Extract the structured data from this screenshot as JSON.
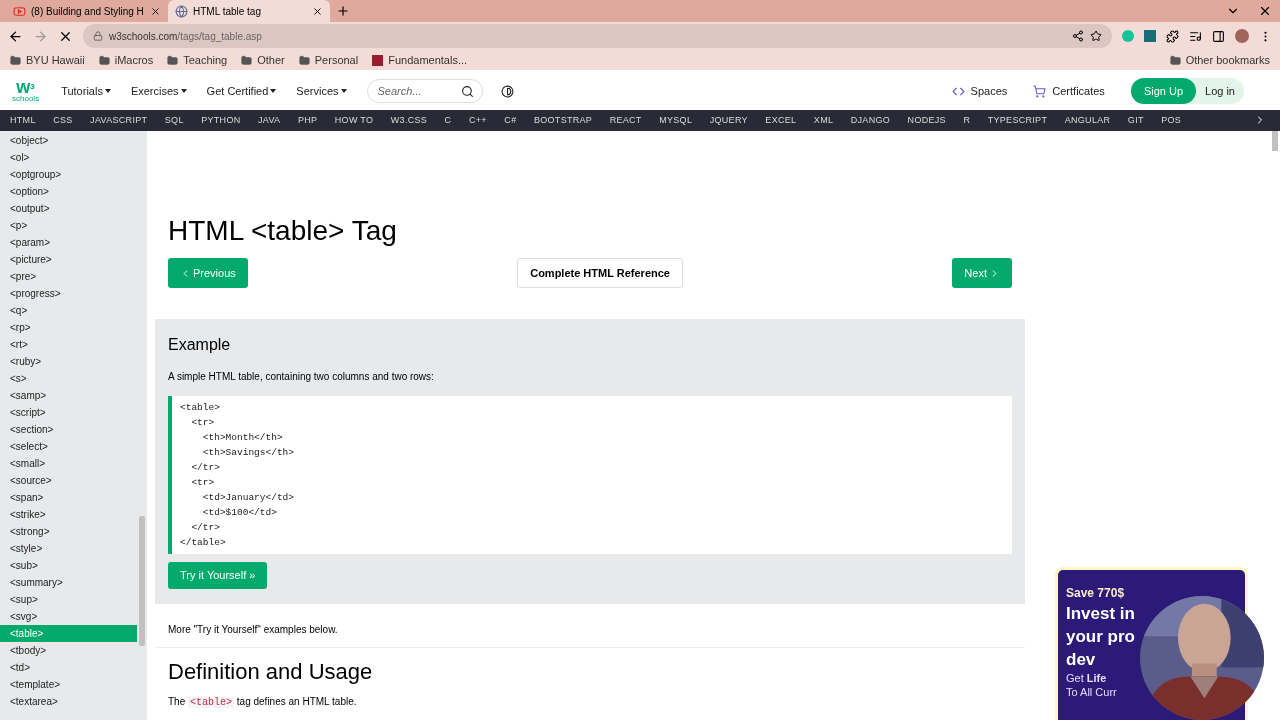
{
  "browser": {
    "tabs": [
      {
        "title": "(8) Building and Styling H",
        "selected": false,
        "kind": "video"
      },
      {
        "title": "HTML table tag",
        "selected": true,
        "kind": "web"
      }
    ],
    "url": {
      "host": "w3schools.com",
      "path": "/tags/tag_table.asp"
    },
    "bookmarks": [
      {
        "label": "BYU Hawaii",
        "kind": "folder"
      },
      {
        "label": "iMacros",
        "kind": "folder"
      },
      {
        "label": "Teaching",
        "kind": "folder"
      },
      {
        "label": "Other",
        "kind": "folder"
      },
      {
        "label": "Personal",
        "kind": "folder"
      },
      {
        "label": "Fundamentals...",
        "kind": "site"
      }
    ],
    "other_bookmarks": "Other bookmarks"
  },
  "header": {
    "logo": {
      "mark": "w",
      "sup": "3",
      "word": "schools"
    },
    "menus": [
      "Tutorials",
      "Exercises",
      "Get Certified",
      "Services"
    ],
    "search": {
      "placeholder": "Search..."
    },
    "links": [
      {
        "label": "Spaces",
        "kind": "code"
      },
      {
        "label": "Certficates",
        "kind": "cart"
      }
    ],
    "sign_up": "Sign Up",
    "log_in": "Log in"
  },
  "topnav": [
    "HTML",
    "CSS",
    "JAVASCRIPT",
    "SQL",
    "PYTHON",
    "JAVA",
    "PHP",
    "HOW TO",
    "W3.CSS",
    "C",
    "C++",
    "C#",
    "BOOTSTRAP",
    "REACT",
    "MYSQL",
    "JQUERY",
    "EXCEL",
    "XML",
    "DJANGO",
    "NODEJS",
    "R",
    "TYPESCRIPT",
    "ANGULAR",
    "GIT",
    "POS"
  ],
  "sidebar": {
    "items": [
      {
        "label": "<object>",
        "selected": false
      },
      {
        "label": "<ol>",
        "selected": false
      },
      {
        "label": "<optgroup>",
        "selected": false
      },
      {
        "label": "<option>",
        "selected": false
      },
      {
        "label": "<output>",
        "selected": false
      },
      {
        "label": "<p>",
        "selected": false
      },
      {
        "label": "<param>",
        "selected": false
      },
      {
        "label": "<picture>",
        "selected": false
      },
      {
        "label": "<pre>",
        "selected": false
      },
      {
        "label": "<progress>",
        "selected": false
      },
      {
        "label": "<q>",
        "selected": false
      },
      {
        "label": "<rp>",
        "selected": false
      },
      {
        "label": "<rt>",
        "selected": false
      },
      {
        "label": "<ruby>",
        "selected": false
      },
      {
        "label": "<s>",
        "selected": false
      },
      {
        "label": "<samp>",
        "selected": false
      },
      {
        "label": "<script>",
        "selected": false
      },
      {
        "label": "<section>",
        "selected": false
      },
      {
        "label": "<select>",
        "selected": false
      },
      {
        "label": "<small>",
        "selected": false
      },
      {
        "label": "<source>",
        "selected": false
      },
      {
        "label": "<span>",
        "selected": false
      },
      {
        "label": "<strike>",
        "selected": false
      },
      {
        "label": "<strong>",
        "selected": false
      },
      {
        "label": "<style>",
        "selected": false
      },
      {
        "label": "<sub>",
        "selected": false
      },
      {
        "label": "<summary>",
        "selected": false
      },
      {
        "label": "<sup>",
        "selected": false
      },
      {
        "label": "<svg>",
        "selected": false
      },
      {
        "label": "<table>",
        "selected": true
      },
      {
        "label": "<tbody>",
        "selected": false
      },
      {
        "label": "<td>",
        "selected": false
      },
      {
        "label": "<template>",
        "selected": false
      },
      {
        "label": "<textarea>",
        "selected": false
      }
    ]
  },
  "main": {
    "title": "HTML <table> Tag",
    "previous": "Previous",
    "reference": "Complete HTML Reference",
    "next": "Next",
    "example": {
      "heading": "Example",
      "intro": "A simple HTML table, containing two columns and two rows:",
      "code": [
        "<table>",
        "  <tr>",
        "    <th>Month</th>",
        "    <th>Savings</th>",
        "  </tr>",
        "  <tr>",
        "    <td>January</td>",
        "    <td>$100</td>",
        "  </tr>",
        "</table>"
      ],
      "try_button": "Try it Yourself »"
    },
    "more": "More \"Try it Yourself\" examples below.",
    "definition_heading": "Definition and Usage",
    "definition": {
      "before": "The",
      "code": "<table>",
      "after": "tag defines an HTML table."
    }
  },
  "ad": {
    "lines": [
      {
        "kind": "small",
        "left": "Save 770$"
      },
      {
        "kind": "big",
        "left": "Invest in"
      },
      {
        "kind": "big",
        "left": "your pro"
      },
      {
        "kind": "big",
        "left": "dev"
      },
      {
        "kind": "sub",
        "left": "Get **Life**"
      },
      {
        "kind": "sub",
        "left": "To All Curr"
      }
    ]
  }
}
